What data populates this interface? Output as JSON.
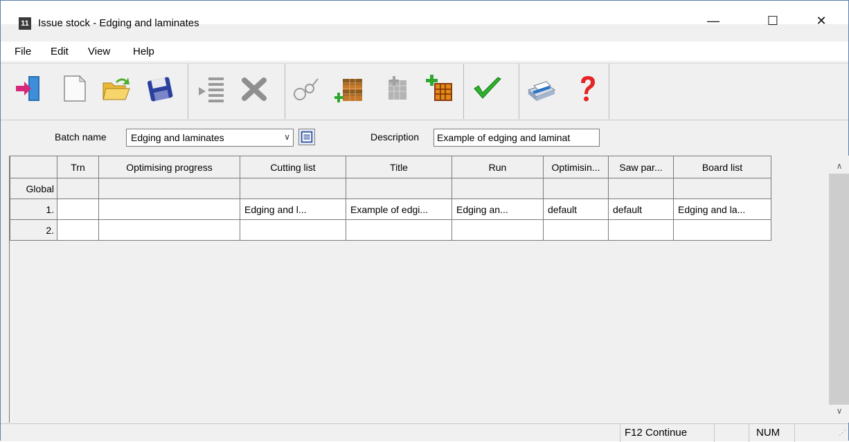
{
  "window": {
    "app_icon_glyph": "11",
    "title": "Issue stock - Edging and laminates",
    "minimize_glyph": "—",
    "maximize_glyph": "☐",
    "close_glyph": "✕"
  },
  "menu": {
    "file": "File",
    "edit": "Edit",
    "view": "View",
    "help": "Help"
  },
  "toolbar": {
    "buttons": [
      "exit-icon",
      "new-icon",
      "open-icon",
      "save-icon",
      "insert-line-icon",
      "delete-icon",
      "search-icon",
      "add-stack-icon",
      "copy-stack-icon",
      "add-board-icon",
      "checkmark-icon",
      "print-icon",
      "help-icon"
    ]
  },
  "batch": {
    "batch_label": "Batch name",
    "batch_value": "Edging and laminates",
    "description_label": "Description",
    "description_value": "Example of edging and laminat"
  },
  "grid": {
    "columns": [
      "Trn",
      "Optimising progress",
      "Cutting list",
      "Title",
      "Run",
      "Optimisin...",
      "Saw par...",
      "Board list"
    ],
    "rows": [
      {
        "head": "Global",
        "cells": [
          "",
          "",
          "",
          "",
          "",
          "",
          "",
          ""
        ]
      },
      {
        "head": "1.",
        "cells": [
          "",
          "",
          "Edging and l...",
          "Example of edgi...",
          "Edging an...",
          "default",
          "default",
          "Edging and la..."
        ]
      },
      {
        "head": "2.",
        "cells": [
          "",
          "",
          "",
          "",
          "",
          "",
          "",
          ""
        ]
      }
    ]
  },
  "status": {
    "continue_text": "F12 Continue",
    "num_text": "NUM"
  },
  "colors": {
    "window_border": "#5a7fa8",
    "chrome": "#f0f0f0",
    "grid_line": "#7a7a7a"
  }
}
